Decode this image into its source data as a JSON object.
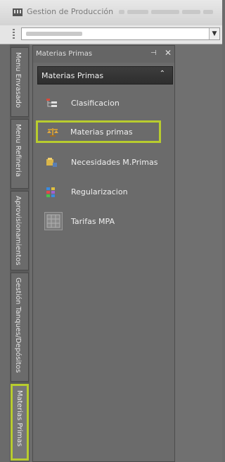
{
  "window": {
    "title": "Gestion de Producción"
  },
  "vertical_tabs": [
    {
      "label": "Menu Envasado"
    },
    {
      "label": "Menu Refineria"
    },
    {
      "label": "Aprovisionamientos"
    },
    {
      "label": "Gestión Tanques/Depósitos"
    },
    {
      "label": "Materias Primas"
    }
  ],
  "panel": {
    "title": "Materias Primas",
    "pin_glyph": "⊣",
    "close_glyph": "✕",
    "group": {
      "label": "Materias Primas",
      "chevron": "⌃"
    },
    "items": [
      {
        "label": "Clasificacion",
        "icon": "hierarchy-icon"
      },
      {
        "label": "Materias primas",
        "icon": "scale-icon"
      },
      {
        "label": "Necesidades M.Primas",
        "icon": "needs-icon"
      },
      {
        "label": "Regularizacion",
        "icon": "blocks-icon"
      },
      {
        "label": "Tarifas MPA",
        "icon": "grid-icon"
      }
    ]
  },
  "colors": {
    "highlight": "#b8cc2e",
    "panel_bg": "#6b6b6b",
    "group_header": "#2e2e2e"
  }
}
